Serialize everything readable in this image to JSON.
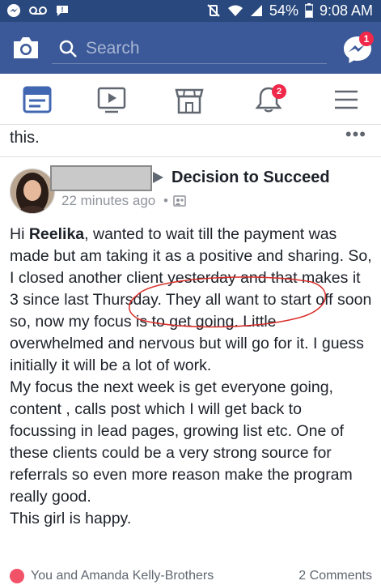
{
  "status_bar": {
    "battery": "54%",
    "time": "9:08 AM"
  },
  "search": {
    "placeholder": "Search"
  },
  "messenger": {
    "badge": "1"
  },
  "notifications": {
    "badge": "2"
  },
  "previous_post": {
    "text": "this."
  },
  "post": {
    "group": "Decision to Succeed",
    "timestamp": "22 minutes ago",
    "separator": "•",
    "body": {
      "greeting": "Hi ",
      "mention": "Reelika",
      "paragraph1": ", wanted to wait till the payment was made but am taking it as a positive and sharing. So, I closed another client yesterday and that makes it 3 since last Thursday. They all want to start off soon so, now my focus is to get going. Little overwhelmed and nervous but will go for it. I guess initially it will be a lot of work.",
      "paragraph2": "My focus the next week is get everyone going, content , calls post which I will get back to focussing in lead pages, growing list etc. One of these clients could be a very strong source for referrals so even more reason make the program really good.",
      "paragraph3": "This girl is happy."
    },
    "reactions": "You and Amanda Kelly-Brothers",
    "comments": "2 Comments"
  },
  "colors": {
    "header": "#3b5998",
    "status_bar": "#29487d",
    "badge": "#f02849",
    "annotation": "#d9302c"
  }
}
